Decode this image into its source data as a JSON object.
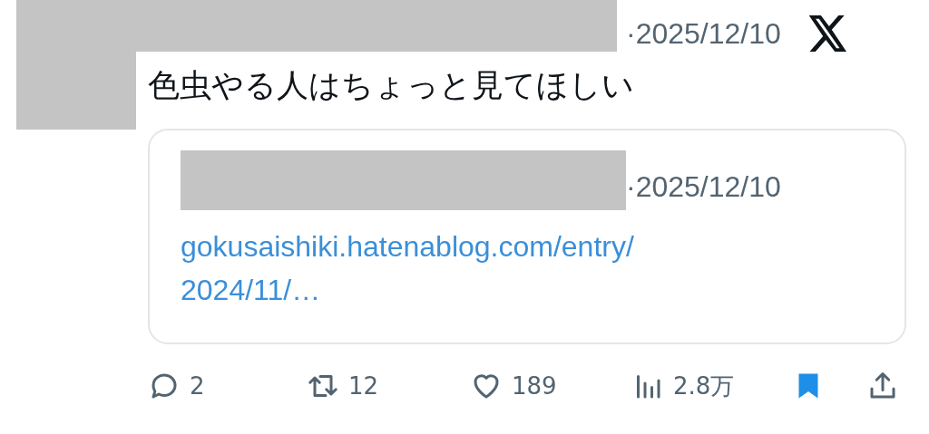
{
  "post": {
    "date": "·2025/12/10",
    "text": "色虫やる人はちょっと見てほしい",
    "quote": {
      "date": "·2025/12/10",
      "link_lines": [
        "gokusaishiki.hatenablog.com/entry/",
        "2024/11/…"
      ]
    },
    "actions": [
      {
        "kind": "reply",
        "count": "2"
      },
      {
        "kind": "repost",
        "count": "12"
      },
      {
        "kind": "like",
        "count": "189"
      },
      {
        "kind": "views",
        "count": "2.8万"
      },
      {
        "kind": "bookmark",
        "selected": true
      },
      {
        "kind": "share"
      }
    ]
  }
}
